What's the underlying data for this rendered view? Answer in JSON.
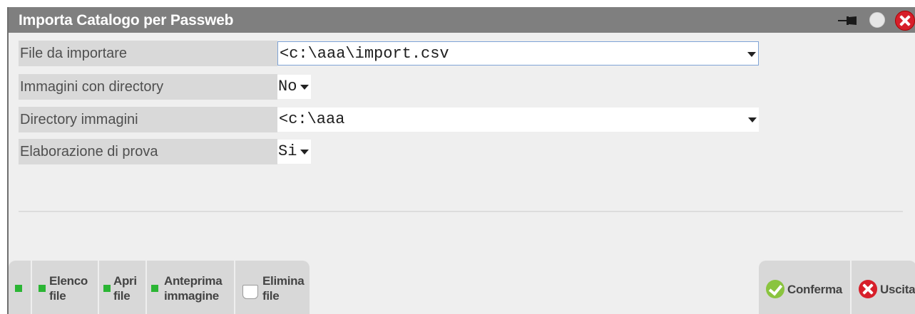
{
  "window": {
    "title": "Importa Catalogo per Passweb"
  },
  "form": {
    "file_da_importare": {
      "label": "File da importare",
      "value": "<c:\\aaa\\import.csv"
    },
    "immagini_con_directory": {
      "label": "Immagini con directory",
      "value": "No"
    },
    "directory_immagini": {
      "label": "Directory immagini",
      "value": "<c:\\aaa"
    },
    "elaborazione_di_prova": {
      "label": "Elaborazione di prova",
      "value": "Si"
    }
  },
  "toolbar_left": {
    "elenco_file": "Elenco\nfile",
    "apri_file": "Apri\nfile",
    "anteprima_immagine": "Anteprima\nimmagine",
    "elimina_file": "Elimina\nfile"
  },
  "toolbar_right": {
    "conferma": "Conferma",
    "uscita": "Uscita"
  },
  "icons": {
    "pin": "pin-icon",
    "minimize": "circle-icon",
    "close": "close-icon",
    "green_square": "green-square-icon",
    "trash": "trash-icon",
    "confirm": "check-icon",
    "exit": "exit-icon"
  },
  "colors": {
    "title_bar": "#7f7f7f",
    "label_bg": "#d9d9d9",
    "accent_green": "#2bb534",
    "close_red": "#d71f2a",
    "focus_border": "#7ea3d6"
  }
}
